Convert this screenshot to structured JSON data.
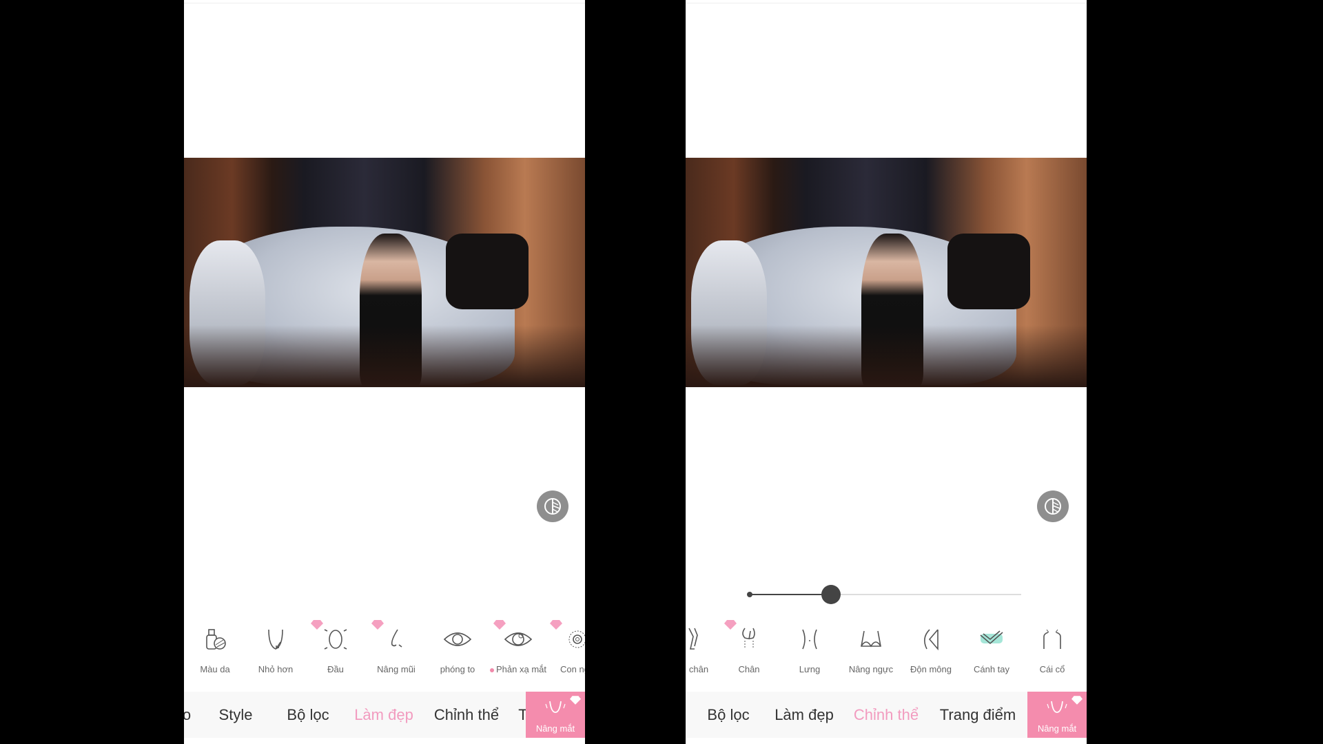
{
  "accent_color": "#f29bbf",
  "left": {
    "tools": [
      {
        "label": "Màu da",
        "icon": "skin-color-icon",
        "premium": false
      },
      {
        "label": "Nhỏ hơn",
        "icon": "chin-slim-icon",
        "premium": false
      },
      {
        "label": "Đầu",
        "icon": "head-icon",
        "premium": true
      },
      {
        "label": "Nâng mũi",
        "icon": "nose-icon",
        "premium": true
      },
      {
        "label": "phóng to",
        "icon": "eye-icon",
        "premium": false
      },
      {
        "label": "Phản xạ mắt",
        "icon": "eye-reflection-icon",
        "premium": true,
        "new_dot": true
      },
      {
        "label": "Con ng",
        "icon": "pupil-icon",
        "premium": true
      }
    ],
    "tabs": [
      "o",
      "Style",
      "Bộ lọc",
      "Làm đẹp",
      "Chỉnh thể",
      "T"
    ],
    "active_tab": "Làm đẹp",
    "feature_button": "Nâng mắt"
  },
  "right": {
    "slider_value": 0.3,
    "tools": [
      {
        "label": "chân",
        "icon": "leg-icon",
        "premium": false
      },
      {
        "label": "Chân",
        "icon": "legs-icon",
        "premium": true
      },
      {
        "label": "Lưng",
        "icon": "waist-icon",
        "premium": false
      },
      {
        "label": "Nâng ngực",
        "icon": "bust-icon",
        "premium": false
      },
      {
        "label": "Độn mông",
        "icon": "hip-icon",
        "premium": false
      },
      {
        "label": "Cánh tay",
        "icon": "arm-icon",
        "premium": false,
        "highlight": "#7fdcc8"
      },
      {
        "label": "Cái cổ",
        "icon": "neck-icon",
        "premium": false
      }
    ],
    "tabs": [
      "Bộ lọc",
      "Làm đẹp",
      "Chỉnh thể",
      "Trang điểm"
    ],
    "active_tab": "Chỉnh thể",
    "feature_button": "Nâng mắt"
  }
}
